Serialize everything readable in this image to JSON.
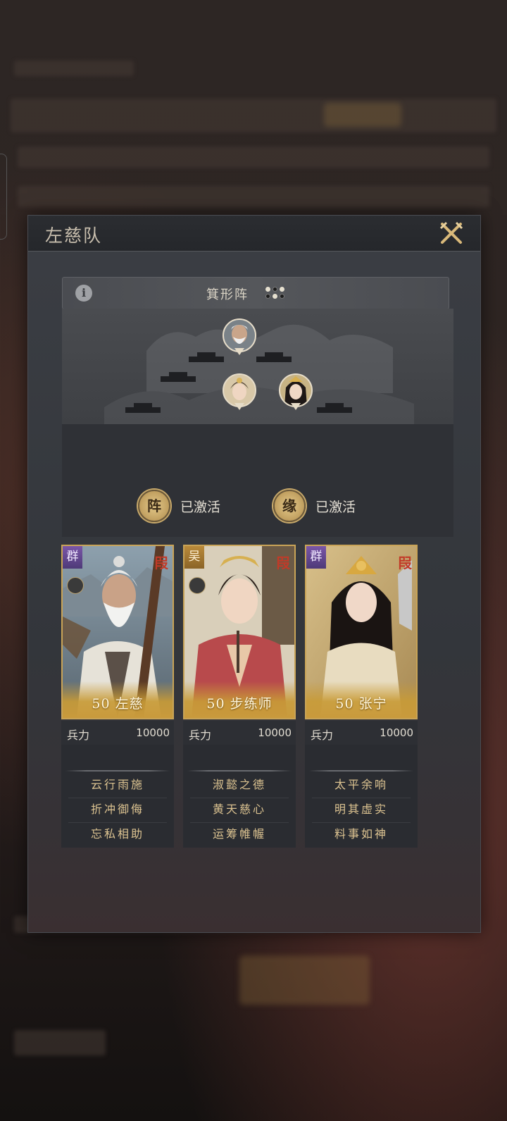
{
  "team": {
    "title": "左慈队",
    "formation": {
      "name": "箕形阵"
    },
    "statuses": [
      {
        "badge": "阵",
        "text": "已激活"
      },
      {
        "badge": "缘",
        "text": "已激活"
      }
    ]
  },
  "icons": {
    "close": "close-swords-icon",
    "info": "info-icon",
    "formation": "formation-dots-icon"
  },
  "colors": {
    "gold": "#c9a457",
    "skill_text": "#dcc391",
    "faction_qun": "#6a4b98",
    "faction_wu": "#a87a32",
    "rank": "#c23a28"
  },
  "generals": [
    {
      "faction": "群",
      "rank": "叚",
      "level": "50",
      "name": "左慈",
      "display": "50 左慈",
      "stat_label": "兵力",
      "stat_value": "10000",
      "skills": [
        "云行雨施",
        "折冲御侮",
        "忘私相助"
      ]
    },
    {
      "faction": "吴",
      "rank": "叚",
      "level": "50",
      "name": "步练师",
      "display": "50 步练师",
      "stat_label": "兵力",
      "stat_value": "10000",
      "skills": [
        "淑懿之德",
        "黄天慈心",
        "运筹帷幄"
      ]
    },
    {
      "faction": "群",
      "rank": "叚",
      "level": "50",
      "name": "张宁",
      "display": "50 张宁",
      "stat_label": "兵力",
      "stat_value": "10000",
      "skills": [
        "太平余响",
        "明其虚实",
        "料事如神"
      ]
    }
  ]
}
